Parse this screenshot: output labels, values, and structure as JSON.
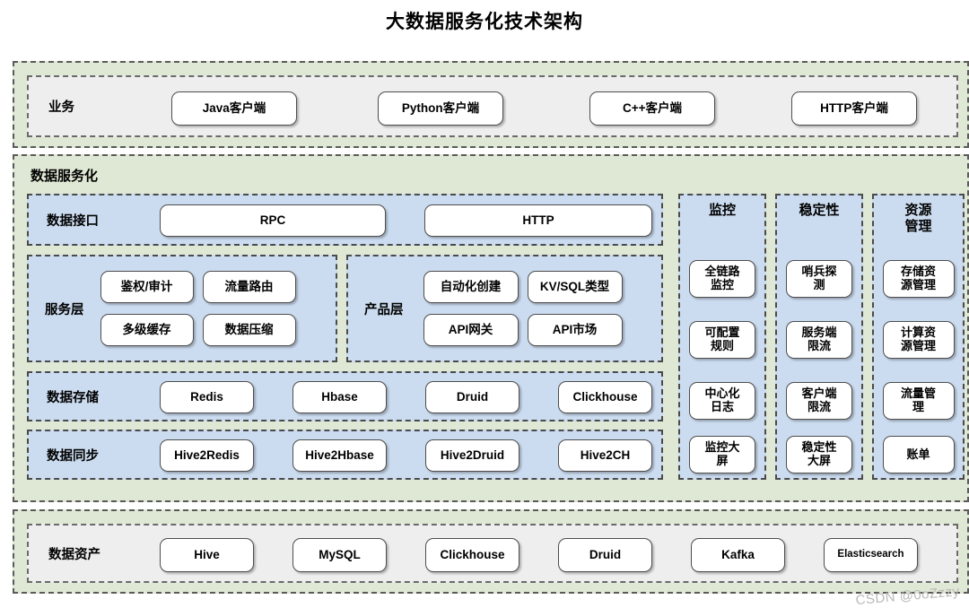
{
  "title": "大数据服务化技术架构",
  "watermark": "CSDN @0oZzzy",
  "colors": {
    "band_green": "#dfe8d4",
    "inner_gray": "#eeeeee",
    "inner_blue": "#ccdcf0",
    "node_white": "#ffffff",
    "border_dash": "#5a5a5a"
  },
  "business": {
    "label": "业务",
    "nodes": [
      {
        "label": "Java客户端"
      },
      {
        "label": "Python客户端"
      },
      {
        "label": "C++客户端"
      },
      {
        "label": "HTTP客户端"
      }
    ]
  },
  "data_service": {
    "title": "数据服务化",
    "interface": {
      "label": "数据接口",
      "nodes": [
        {
          "label": "RPC"
        },
        {
          "label": "HTTP"
        }
      ]
    },
    "service_layer": {
      "label": "服务层",
      "nodes": [
        {
          "label": "鉴权/审计"
        },
        {
          "label": "流量路由"
        },
        {
          "label": "多级缓存"
        },
        {
          "label": "数据压缩"
        }
      ]
    },
    "product_layer": {
      "label": "产品层",
      "nodes": [
        {
          "label": "自动化创建"
        },
        {
          "label": "KV/SQL类型"
        },
        {
          "label": "API网关"
        },
        {
          "label": "API市场"
        }
      ]
    },
    "storage": {
      "label": "数据存储",
      "nodes": [
        {
          "label": "Redis"
        },
        {
          "label": "Hbase"
        },
        {
          "label": "Druid"
        },
        {
          "label": "Clickhouse"
        }
      ]
    },
    "sync": {
      "label": "数据同步",
      "nodes": [
        {
          "label": "Hive2Redis"
        },
        {
          "label": "Hive2Hbase"
        },
        {
          "label": "Hive2Druid"
        },
        {
          "label": "Hive2CH"
        }
      ]
    },
    "monitoring": {
      "title": "监控",
      "nodes": [
        {
          "label": "全链路\n监控"
        },
        {
          "label": "可配置\n规则"
        },
        {
          "label": "中心化\n日志"
        },
        {
          "label": "监控大\n屏"
        }
      ]
    },
    "stability": {
      "title": "稳定性",
      "nodes": [
        {
          "label": "哨兵探\n测"
        },
        {
          "label": "服务端\n限流"
        },
        {
          "label": "客户端\n限流"
        },
        {
          "label": "稳定性\n大屏"
        }
      ]
    },
    "resource": {
      "title": "资源\n管理",
      "nodes": [
        {
          "label": "存储资\n源管理"
        },
        {
          "label": "计算资\n源管理"
        },
        {
          "label": "流量管\n理"
        },
        {
          "label": "账单"
        }
      ]
    }
  },
  "data_assets": {
    "label": "数据资产",
    "nodes": [
      {
        "label": "Hive"
      },
      {
        "label": "MySQL"
      },
      {
        "label": "Clickhouse"
      },
      {
        "label": "Druid"
      },
      {
        "label": "Kafka"
      },
      {
        "label": "Elasticsearch"
      }
    ]
  }
}
